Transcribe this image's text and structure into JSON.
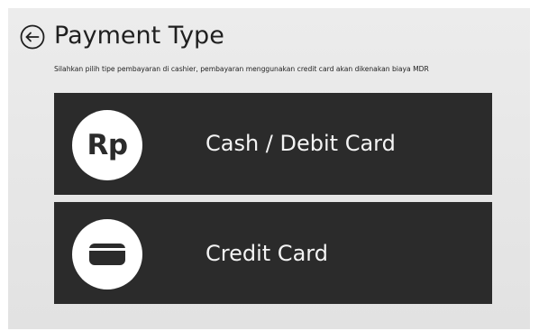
{
  "header": {
    "back_icon": "circle-arrow-left-icon",
    "title": "Payment Type",
    "subtitle": "Silahkan pilih tipe pembayaran di cashier, pembayaran menggunakan credit card akan dikenakan biaya MDR"
  },
  "options": [
    {
      "icon": "rupiah-icon",
      "icon_text": "Rp",
      "label": "Cash / Debit Card"
    },
    {
      "icon": "credit-card-icon",
      "label": "Credit Card"
    }
  ],
  "colors": {
    "background": "#e6e6e6",
    "option_bg": "#2b2b2b",
    "option_text": "#f4f4f4",
    "icon_circle": "#ffffff"
  }
}
